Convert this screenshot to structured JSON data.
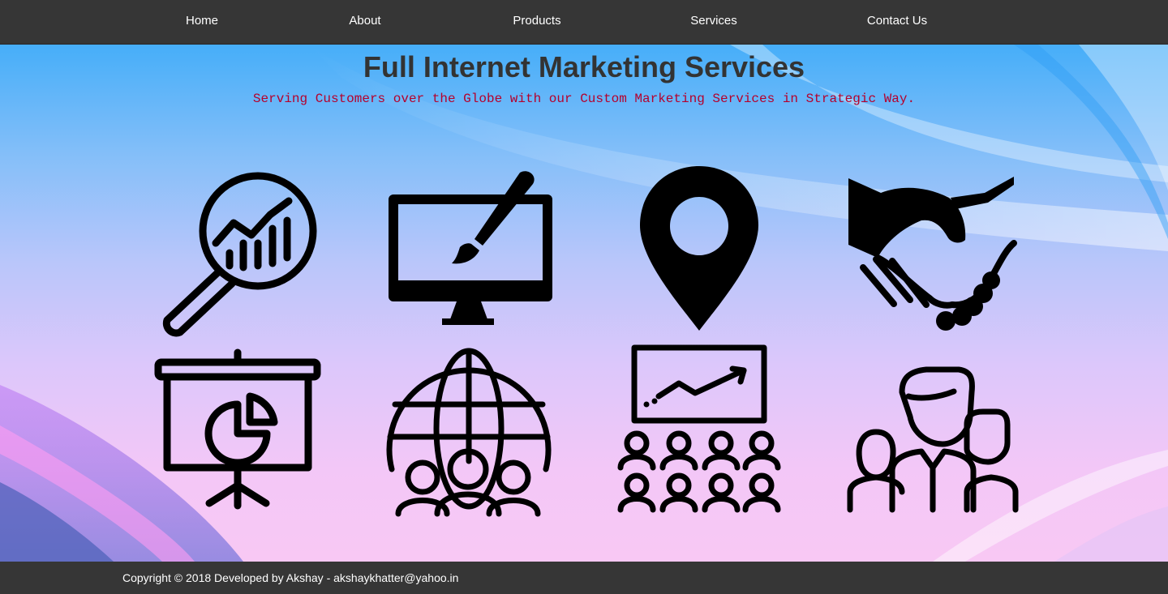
{
  "nav": {
    "items": [
      {
        "label": "Home"
      },
      {
        "label": "About"
      },
      {
        "label": "Products"
      },
      {
        "label": "Services"
      },
      {
        "label": "Contact Us"
      }
    ]
  },
  "hero": {
    "title": "Full Internet Marketing Services",
    "subtitle": "Serving Customers over the Globe with our Custom Marketing Services in Strategic Way."
  },
  "icons": [
    "analytics-magnifier-icon",
    "monitor-paintbrush-icon",
    "location-pin-icon",
    "handshake-icon",
    "presentation-pie-chart-icon",
    "globe-team-icon",
    "audience-growth-chart-icon",
    "team-people-icon"
  ],
  "footer": {
    "copyright": "Copyright © 2018 Developed by Akshay - akshaykhatter@yahoo.in"
  },
  "colors": {
    "nav_bg": "#363636",
    "title": "#333333",
    "subtitle": "#b5002c",
    "icon": "#000000"
  }
}
